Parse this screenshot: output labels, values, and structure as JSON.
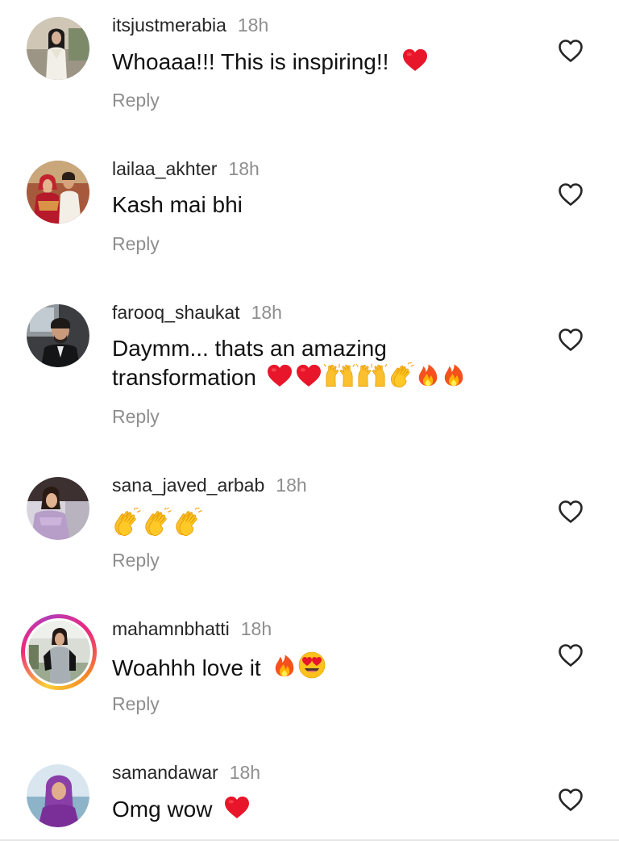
{
  "comments": [
    {
      "username": "itsjustmerabia",
      "time": "18h",
      "text": "Whoaaa!!! This is inspiring!!",
      "emojis": [
        "red-heart"
      ],
      "reply": "Reply",
      "has_story": false
    },
    {
      "username": "lailaa_akhter",
      "time": "18h",
      "text": "Kash mai bhi",
      "emojis": [],
      "reply": "Reply",
      "has_story": false
    },
    {
      "username": "farooq_shaukat",
      "time": "18h",
      "text_line1": "Daymm... thats an amazing",
      "text_line2": "transformation",
      "emojis": [
        "red-heart",
        "red-heart",
        "raising-hands",
        "raising-hands",
        "clapping-hands",
        "fire",
        "fire"
      ],
      "reply": "Reply",
      "has_story": false
    },
    {
      "username": "sana_javed_arbab",
      "time": "18h",
      "text": "",
      "emojis": [
        "clapping-hands",
        "clapping-hands",
        "clapping-hands"
      ],
      "reply": "Reply",
      "has_story": false
    },
    {
      "username": "mahamnbhatti",
      "time": "18h",
      "text": "Woahhh love it",
      "emojis": [
        "fire",
        "heart-eyes"
      ],
      "reply": "Reply",
      "has_story": true
    },
    {
      "username": "samandawar",
      "time": "18h",
      "text": "Omg wow",
      "emojis": [
        "red-heart"
      ],
      "reply": "",
      "has_story": false
    }
  ],
  "colors": {
    "username": "#262626",
    "muted": "#8e8e8e",
    "heart_red": "#e8162a",
    "story_ring_start": "#f9ce34",
    "story_ring_mid": "#ee2a7b",
    "story_ring_end": "#6228d7"
  },
  "icons": {
    "like": "heart-outline-icon"
  }
}
